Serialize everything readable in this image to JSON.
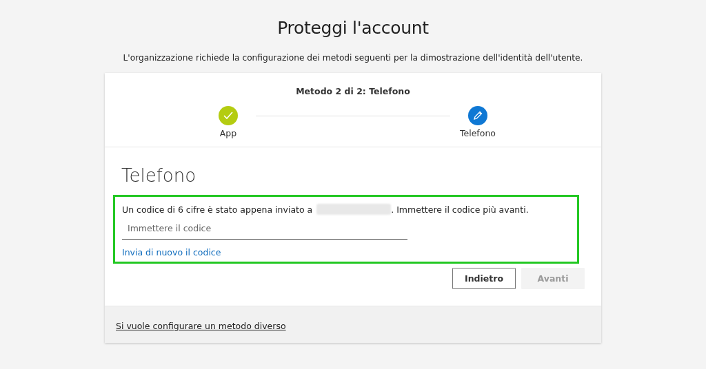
{
  "title": "Proteggi l'account",
  "subtitle": "L'organizzazione richiede la configurazione dei metodi seguenti per la dimostrazione dell'identità dell'utente.",
  "card": {
    "step_caption": "Metodo 2 di 2: Telefono",
    "steps": [
      {
        "label": "App",
        "kind": "done"
      },
      {
        "label": "Telefono",
        "kind": "edit"
      }
    ],
    "heading": "Telefono",
    "message_before": "Un codice di 6 cifre è stato appena inviato a",
    "message_after": ". Immettere il codice più avanti.",
    "code_field": {
      "placeholder": "Immettere il codice"
    },
    "resend_link": "Invia di nuovo il codice",
    "buttons": [
      {
        "label": "Indietro",
        "disabled": false
      },
      {
        "label": "Avanti",
        "disabled": true
      }
    ],
    "footer_link": "Si vuole configurare un metodo diverso"
  }
}
